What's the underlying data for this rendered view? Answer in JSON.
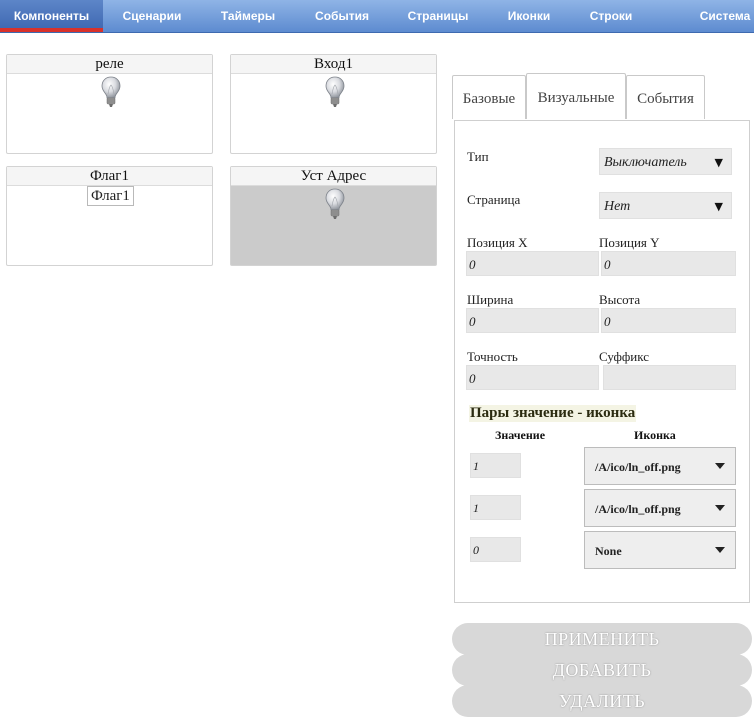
{
  "nav": {
    "tabs": [
      "Компоненты",
      "Сценарии",
      "Таймеры",
      "События",
      "Страницы",
      "Иконки",
      "Строки",
      "Система"
    ],
    "active": "Компоненты"
  },
  "cards": [
    {
      "title": "реле",
      "content": "bulb-icon"
    },
    {
      "title": "Вход1",
      "content": "bulb-icon"
    },
    {
      "title": "Флаг1",
      "value": "Флаг1"
    },
    {
      "title": "Уст Адрес",
      "content": "bulb-icon"
    }
  ],
  "side_tabs": [
    "Базовые",
    "Визуальные",
    "События"
  ],
  "side_tab_active": "Визуальные",
  "form": {
    "type_label": "Тип",
    "type_value": "Выключатель",
    "page_label": "Страница",
    "page_value": "Нет",
    "posx_label": "Позиция X",
    "posx_value": "0",
    "posy_label": "Позиция Y",
    "posy_value": "0",
    "width_label": "Ширина",
    "width_value": "0",
    "height_label": "Высота",
    "height_value": "0",
    "precision_label": "Точность",
    "precision_value": "0",
    "suffix_label": "Суффикс",
    "suffix_value": ""
  },
  "pairs": {
    "title": "Пары значение - иконка",
    "col_value": "Значение",
    "col_icon": "Иконка",
    "rows": [
      {
        "value": "1",
        "icon": "/A/ico/ln_off.png"
      },
      {
        "value": "1",
        "icon": "/A/ico/ln_off.png"
      },
      {
        "value": "0",
        "icon": "None"
      }
    ]
  },
  "buttons": {
    "apply": "ПРИМЕНИТЬ",
    "add": "ДОБАВИТЬ",
    "delete": "УДАЛИТЬ"
  },
  "colors": {
    "nav_bg": "#6f9ad8",
    "nav_active_underline": "#d9322b",
    "button_bg": "#d8d8d8",
    "active_card_bg": "#cbcbcb"
  }
}
